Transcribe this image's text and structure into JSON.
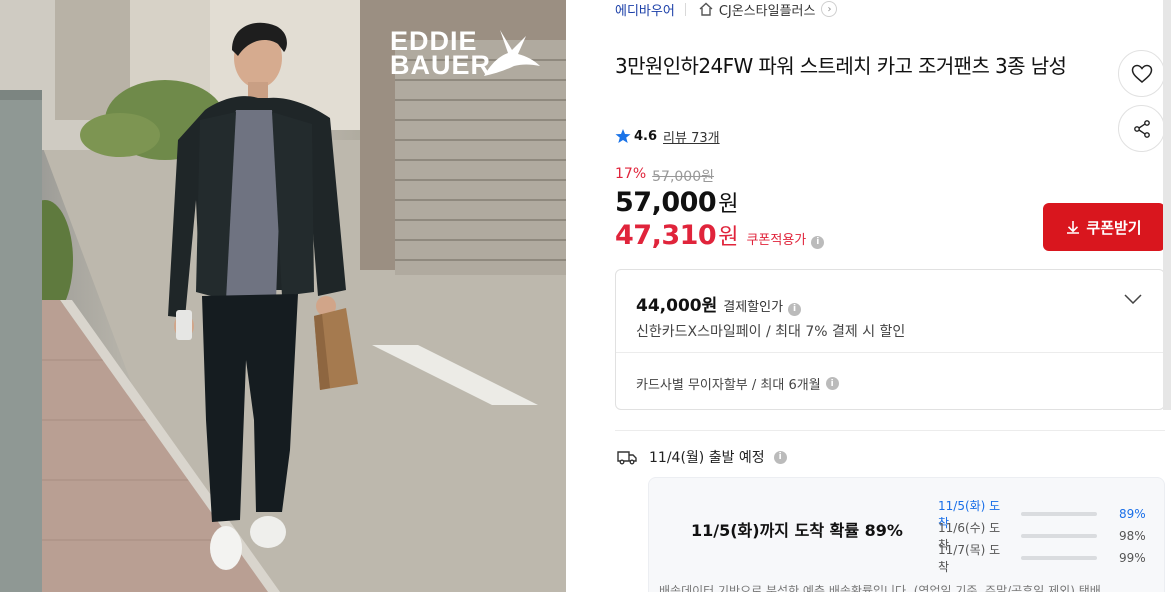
{
  "product_image": {
    "alt": "Eddie Bauer model walking in jogger pants",
    "brand_logo_line1": "EDDIE",
    "brand_logo_line2": "BAUER"
  },
  "breadcrumb": {
    "brand": "에디바우어",
    "store": "CJ온스타일플러스"
  },
  "product": {
    "title": "3만원인하24FW 파워 스트레치 카고 조거팬츠 3종 남성",
    "rating": "4.6",
    "reviews": "리뷰 73개"
  },
  "price": {
    "discount_pct": "17%",
    "original": "57,000원",
    "sale": "57,000",
    "sale_unit": "원",
    "coupon_price": "47,310",
    "coupon_unit": "원",
    "coupon_label": "쿠폰적용가"
  },
  "coupon_button": {
    "label": "쿠폰받기"
  },
  "benefit": {
    "amount": "44,000원",
    "amount_label": "결제할인가",
    "description": "신한카드X스마일페이 / 최대 7% 결제 시 할인",
    "installment": "카드사별 무이자할부 / 최대 6개월"
  },
  "shipping": {
    "departure": "11/4(월) 출발 예정",
    "headline": "11/5(화)까지 도착 확률 89%",
    "rows": [
      {
        "date": "11/5(화) 도착",
        "percent": "89%",
        "ratio": 0.89
      },
      {
        "date": "11/6(수) 도착",
        "percent": "98%",
        "ratio": 0.98
      },
      {
        "date": "11/7(목) 도착",
        "percent": "99%",
        "ratio": 0.99
      }
    ],
    "note": "배송데이터 기반으로 분석한 예측 배송확률입니다. (영업일 기준, 주말/공휴일 제외) 택배"
  },
  "colors": {
    "accent_red": "#d9161e",
    "discount_red": "#e0243b",
    "link_blue": "#1b3fa8",
    "progress_blue": "#2b7bf0",
    "star_blue": "#1a73e8"
  }
}
